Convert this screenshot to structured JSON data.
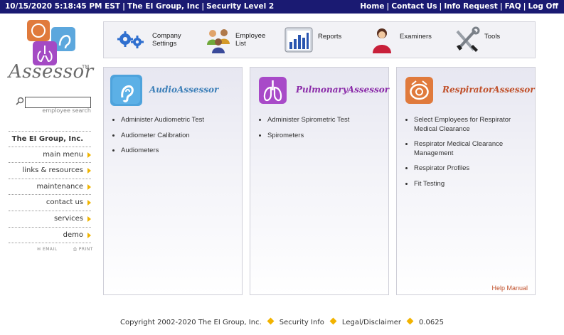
{
  "topbar": {
    "datetime": "10/15/2020 5:18:45 PM EST",
    "company": "The EI Group, Inc",
    "security": "Security Level 2",
    "links": [
      "Home",
      "Contact Us",
      "Info Request",
      "FAQ",
      "Log Off"
    ]
  },
  "logo": {
    "text": "Assessor",
    "tm": "TM"
  },
  "search": {
    "value": "",
    "caption": "employee search"
  },
  "nav": {
    "items": [
      {
        "label": "The EI Group, Inc.",
        "arrow": false
      },
      {
        "label": "main menu",
        "arrow": true
      },
      {
        "label": "links & resources",
        "arrow": true
      },
      {
        "label": "maintenance",
        "arrow": true
      },
      {
        "label": "contact us",
        "arrow": true
      },
      {
        "label": "services",
        "arrow": true
      },
      {
        "label": "demo",
        "arrow": true
      }
    ],
    "email": "EMAIL",
    "print": "PRINT"
  },
  "toolbar": {
    "company_settings": [
      "Company",
      "Settings"
    ],
    "employee_list": [
      "Employee",
      "List"
    ],
    "reports": "Reports",
    "examiners": "Examiners",
    "tools": "Tools"
  },
  "panels": {
    "audio": {
      "title": "AudioAssessor",
      "color": "#3c7fb8",
      "items": [
        "Administer Audiometric Test",
        "Audiometer Calibration",
        "Audiometers"
      ]
    },
    "pulmonary": {
      "title": "PulmonaryAssessor",
      "color": "#8a2aa8",
      "items": [
        "Administer Spirometric Test",
        "Spirometers"
      ]
    },
    "respirator": {
      "title": "RespiratorAssessor",
      "color": "#c0502a",
      "items": [
        "Select Employees for Respirator Medical Clearance",
        "Respirator Medical Clearance Management",
        "Respirator Profiles",
        "Fit Testing"
      ],
      "help": "Help Manual"
    }
  },
  "footer": {
    "copyright": "Copyright 2002-2020 The EI Group, Inc.",
    "security_info": "Security Info",
    "legal": "Legal/Disclaimer",
    "version": "0.0625"
  }
}
